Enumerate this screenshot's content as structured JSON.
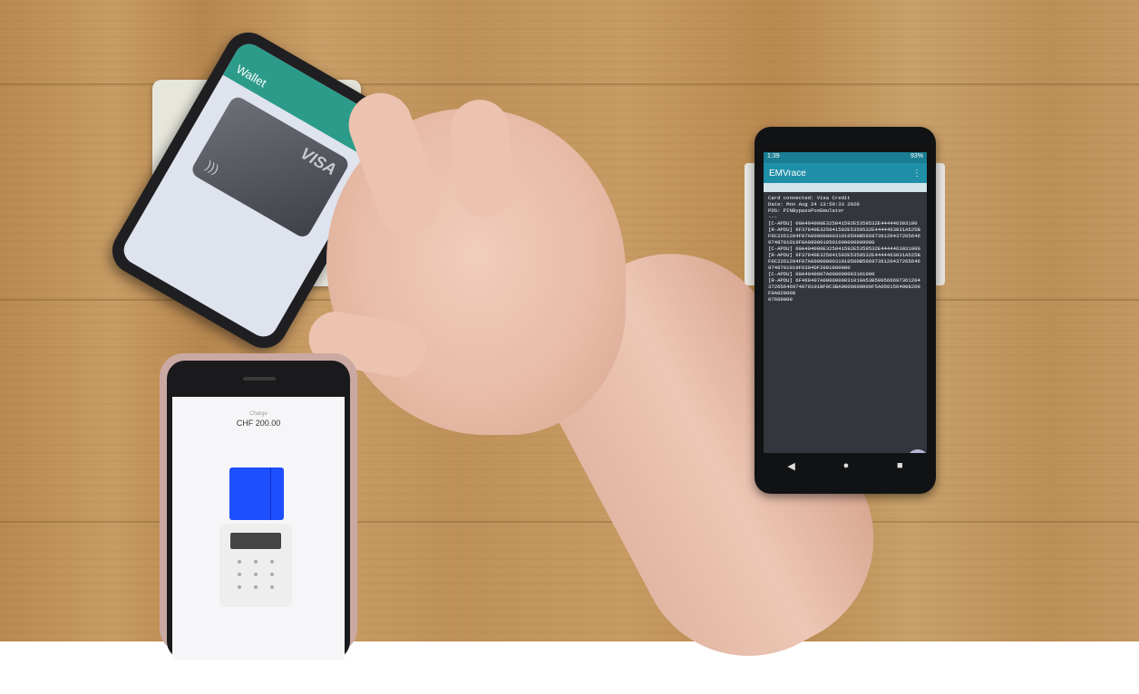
{
  "wallet_phone": {
    "app_title": "Wallet",
    "card_brand": "VISA"
  },
  "emvrace_phone": {
    "status_time": "1:39",
    "battery": "93%",
    "app_title": "EMVrace",
    "menu_icon": "more-vert-icon",
    "log_lines": [
      "Card connected: Visa Credit",
      "Date: Mon Aug 24 13:59:33 2020",
      "POS: PINBypassPosEmulator",
      "---",
      "[C-APDU] 00A404000E325041592E5359532E444446303100",
      "[R-APDU] 6F37840E325041592E5359532E4444463031A525BF0C2261204F07A0000000031010500B56697361204372656469748701019F0A0800010501000000009000",
      "[C-APDU] 00A404000E325041592E5359532E4444463031000",
      "[R-APDU] 6F37840E325041592E5359532E4444463031A525BF0C2261204F07A0000000031010500B56697361204372656469748701019F6304DF2001800000",
      "[C-APDU] 00A4040007A000000003101000",
      "[R-APDU] 6F468407A0000000031010A53B50056669736120437265646974870101BF0C3BA0000000009F5A0501564008209F0A020000",
      "07669000"
    ],
    "nav_back": "◀",
    "nav_home": "●",
    "nav_recent": "■"
  },
  "iphone": {
    "label": "Charge",
    "amount": "CHF 200.00"
  }
}
